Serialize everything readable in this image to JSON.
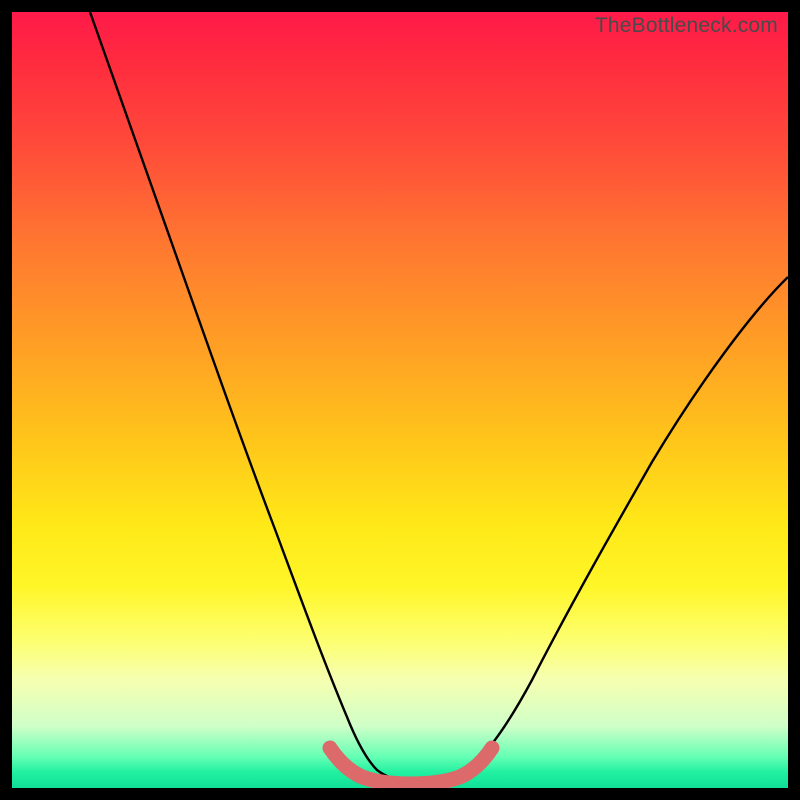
{
  "watermark": "TheBottleneck.com",
  "chart_data": {
    "type": "line",
    "title": "",
    "xlabel": "",
    "ylabel": "",
    "xlim": [
      0,
      100
    ],
    "ylim": [
      0,
      100
    ],
    "series": [
      {
        "name": "curve",
        "x": [
          10,
          14,
          18,
          22,
          26,
          30,
          34,
          38,
          40,
          42,
          44,
          46,
          48,
          50,
          52,
          54,
          56,
          60,
          64,
          68,
          72,
          76,
          80,
          84,
          88,
          92,
          96,
          100
        ],
        "y": [
          100,
          90,
          80,
          70,
          60,
          50,
          41,
          32,
          28,
          24,
          20,
          15,
          10,
          5,
          3,
          2,
          2,
          3,
          6,
          12,
          19,
          27,
          35,
          43,
          50,
          56,
          61,
          65
        ]
      }
    ],
    "highlight": {
      "name": "bottom-band",
      "color": "#e06a6a",
      "x": [
        40,
        42,
        44,
        46,
        48,
        50,
        52,
        54,
        56,
        58
      ],
      "y": [
        6,
        4,
        3,
        2,
        2,
        2,
        2,
        2,
        3,
        4
      ]
    },
    "background": "rainbow-vertical-gradient"
  }
}
